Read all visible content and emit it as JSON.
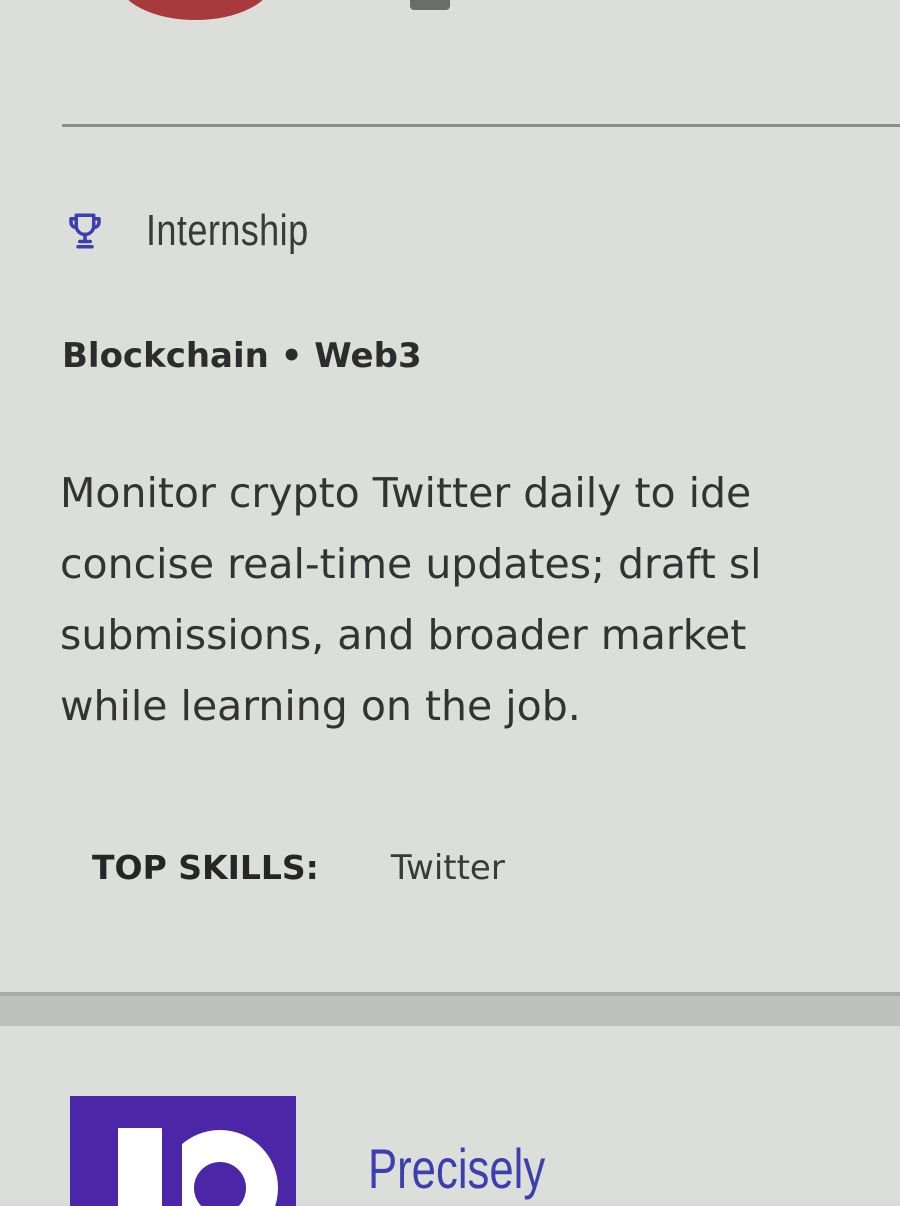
{
  "job": {
    "type_label": "Internship",
    "type_icon": "trophy-icon",
    "category": "Blockchain • Web3",
    "description_lines": [
      "Monitor crypto Twitter daily to ide",
      "concise real-time updates; draft sl",
      "submissions, and broader market",
      "while learning on the job."
    ],
    "skills_label": "TOP SKILLS:",
    "skills": [
      "Twitter"
    ]
  },
  "next_job": {
    "company_name": "Precisely",
    "logo_color": "#4b27a8"
  },
  "colors": {
    "background": "#dcded9",
    "accent": "#3b3faf",
    "previous_logo": "#a8393c"
  }
}
